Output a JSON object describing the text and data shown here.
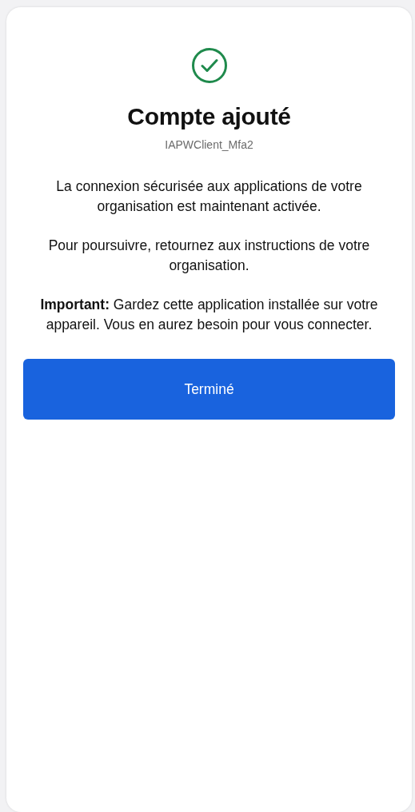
{
  "title": "Compte ajouté",
  "subtitle": "IAPWClient_Mfa2",
  "paragraphs": [
    "La connexion sécurisée aux applications de votre organisation est maintenant activée.",
    "Pour poursuivre, retournez aux instructions de votre organisation.",
    "**Important:** Gardez cette application installée sur votre appareil. Vous en aurez besoin pour vous connecter."
  ],
  "button": {
    "label": "Terminé"
  }
}
